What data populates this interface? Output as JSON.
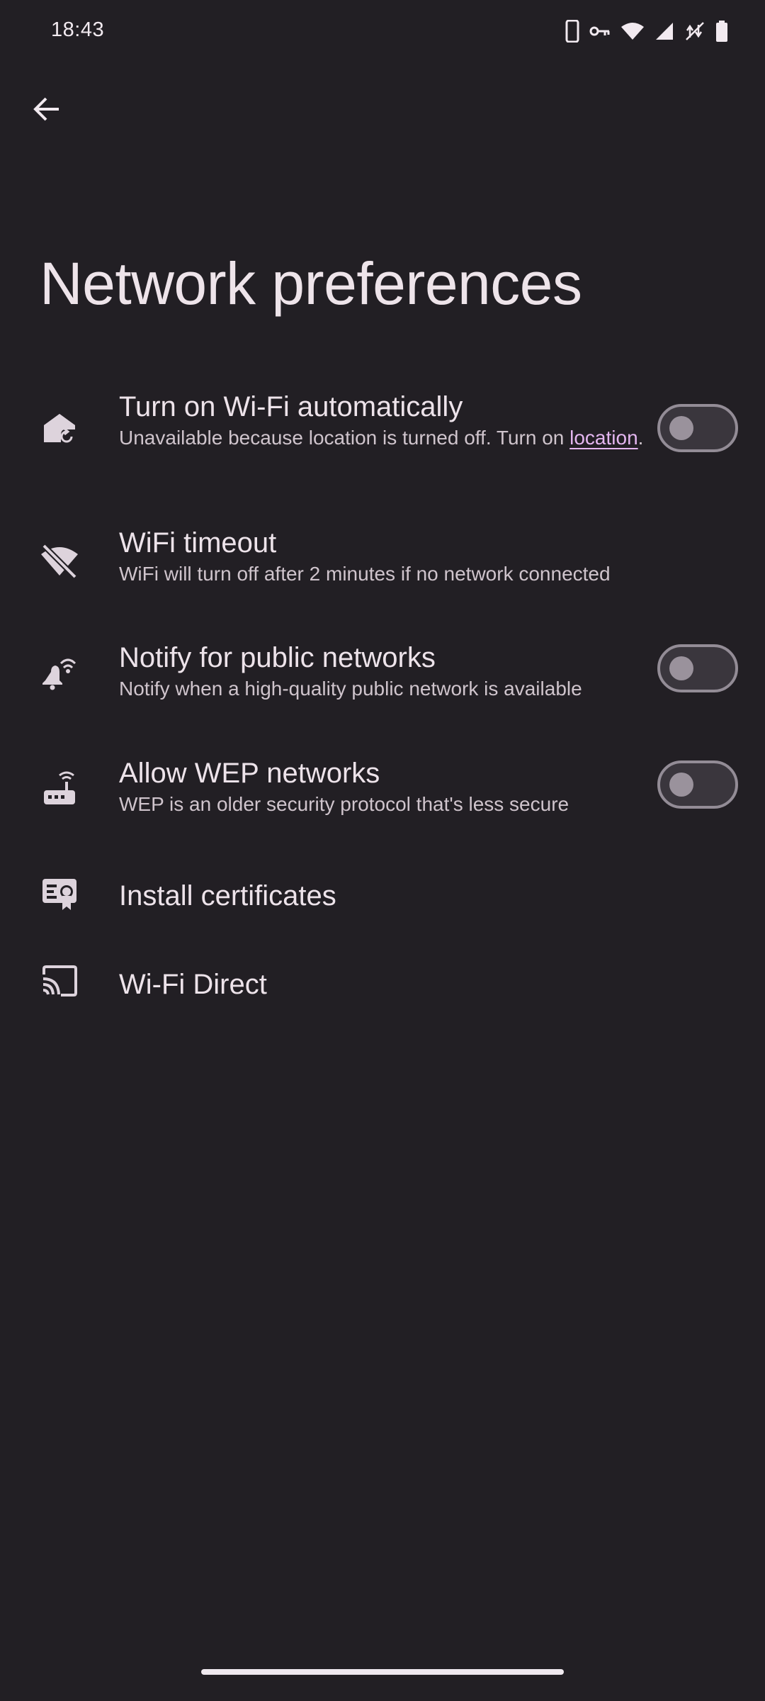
{
  "status_bar": {
    "time": "18:43",
    "icons": [
      "phone-icon",
      "vpn-key-icon",
      "wifi-icon",
      "cell-signal-icon",
      "no-data-icon",
      "battery-icon"
    ]
  },
  "app_bar": {
    "back_icon": "arrow-back-icon",
    "title": "Network preferences"
  },
  "preferences": [
    {
      "id": "wifi-auto",
      "icon": "home-sync-icon",
      "title": "Turn on Wi-Fi automatically",
      "summary_prefix": "Unavailable because location is turned off. Turn on ",
      "summary_link": "location",
      "summary_suffix": ".",
      "toggle": "off"
    },
    {
      "id": "wifi-timeout",
      "icon": "wifi-off-icon",
      "title": "WiFi timeout",
      "summary": "WiFi will turn off after 2 minutes if no network connected"
    },
    {
      "id": "notify-public",
      "icon": "notification-wifi-icon",
      "title": "Notify for public networks",
      "summary": "Notify when a high-quality public network is available",
      "toggle": "off"
    },
    {
      "id": "allow-wep",
      "icon": "router-icon",
      "title": "Allow WEP networks",
      "summary": "WEP is an older security protocol that's less secure",
      "toggle": "off"
    },
    {
      "id": "install-certs",
      "icon": "certificate-icon",
      "title": "Install certificates"
    },
    {
      "id": "wifi-direct",
      "icon": "cast-icon",
      "title": "Wi-Fi Direct"
    }
  ],
  "colors": {
    "background": "#221f24",
    "text_primary": "#ede3ea",
    "text_secondary": "#cfc4cc",
    "link": "#e4b6f0",
    "switch_outline": "#938c96"
  }
}
